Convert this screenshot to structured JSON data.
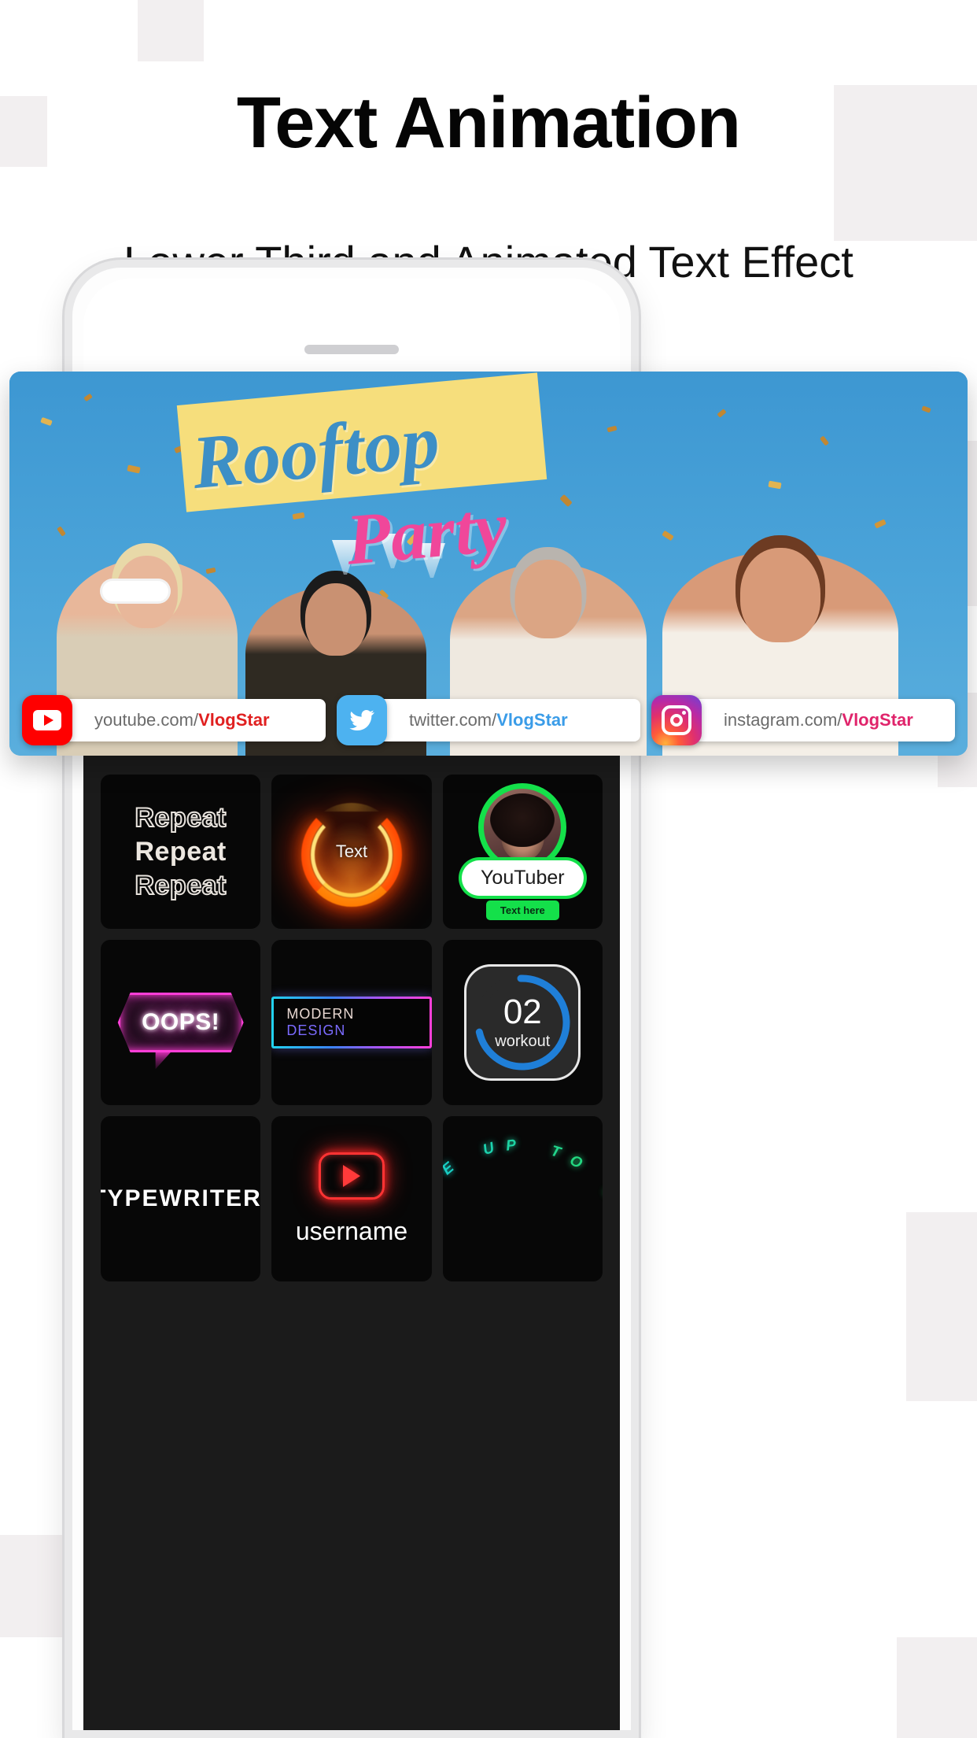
{
  "header": {
    "title": "Text Animation",
    "subtitle": "Lower Third and Animated Text Effect"
  },
  "video_card": {
    "title_line1": "Rooftop",
    "title_line2": "Party",
    "social": [
      {
        "icon": "youtube-icon",
        "prefix": "youtube.com/",
        "handle": "VlogStar",
        "handle_color": "#e02020"
      },
      {
        "icon": "twitter-icon",
        "prefix": "twitter.com/",
        "handle": "VlogStar",
        "handle_color": "#3a9ce8"
      },
      {
        "icon": "instagram-icon",
        "prefix": "instagram.com/",
        "handle": "VlogStar",
        "handle_color": "#e0246b"
      }
    ]
  },
  "templates": [
    {
      "id": "repeat",
      "lines": [
        "Repeat",
        "Repeat",
        "Repeat"
      ]
    },
    {
      "id": "fire-text",
      "label": "Text"
    },
    {
      "id": "youtuber-card",
      "name": "YouTuber",
      "badge": "Text here",
      "accent": "#14e04a"
    },
    {
      "id": "oops-neon",
      "label": "OOPS!",
      "accent": "#ff3fd8"
    },
    {
      "id": "modern-design",
      "label_part1": "MODERN",
      "label_part2": " DESIGN"
    },
    {
      "id": "workout-ring",
      "number": "02",
      "label": "workout",
      "accent": "#1f7fd8",
      "progress_pct": 72
    },
    {
      "id": "typewriter",
      "label": "TYPEWRITER."
    },
    {
      "id": "username-neon",
      "label": "username",
      "accent": "#ff3333"
    },
    {
      "id": "swipe-arc",
      "label": "SWIPE UP TO SHOP",
      "color_start": "#12c8f0",
      "color_end": "#2ce04a"
    }
  ]
}
